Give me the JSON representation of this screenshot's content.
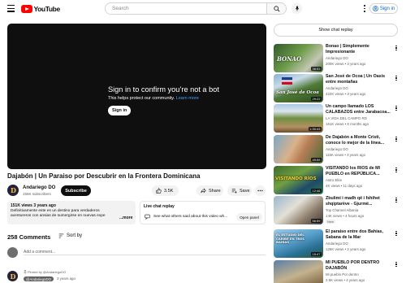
{
  "header": {
    "logo_text": "YouTube",
    "search_placeholder": "Search",
    "signin_label": "Sign in"
  },
  "player": {
    "title": "Sign in to confirm you’re not a bot",
    "subtitle": "This helps protect our community.",
    "learn_more": "Learn more",
    "signin_label": "Sign in"
  },
  "video": {
    "title": "Dajabón | Un Paraiso por Descubrir en la Frontera Dominicana",
    "channel": "Andariego DO",
    "subscribers": "156K subscribers",
    "subscribe_label": "Subscribe",
    "likes": "3.5K",
    "share_label": "Share",
    "save_label": "Save",
    "views_line": "151K views  3 years ago",
    "description": "Definitivamente este es un destino para verdaderos aventureros con ansias de sumergirse en nuevas expe",
    "more_label": "...more"
  },
  "chat_replay": {
    "title": "Live chat replay",
    "text": "See what others said about this video wh...",
    "button": "Open panel"
  },
  "comments": {
    "count_label": "258 Comments",
    "sort_label": "Sort by",
    "add_placeholder": "Add a comment...",
    "pinned_label": "Pinned by @AndariegoDO",
    "first_author": "@AndariegoDO",
    "first_time": "3 years ago"
  },
  "sidebar": {
    "show_chat_label": "Show chat replay",
    "recommendations": [
      {
        "title": "Bonao | Simplemente Impresionante",
        "channel": "Andariego DO",
        "meta": "200K views • 3 years ago",
        "duration": "38:53",
        "badge": "",
        "thumb_text": "BONAO"
      },
      {
        "title": "San José de Ocoa | Un Oasis entre montañas",
        "channel": "Andariego DO",
        "meta": "422K views • 3 years ago",
        "duration": "29:22",
        "badge": "",
        "thumb_text": "San José de Ocoa"
      },
      {
        "title": "Un campo llamado LOS CALABAZOS entre Jarabacoa...",
        "channel": "LA VIDA DEL CAMPO RD",
        "meta": "161K views • 8 months ago",
        "duration": "1:30:43",
        "badge": "",
        "thumb_text": ""
      },
      {
        "title": "De Dajabón a Monte Cristi, conoce lo mejor de la línea...",
        "channel": "Andariego DO",
        "meta": "115K views • 3 years ago",
        "duration": "49:59",
        "badge": "",
        "thumb_text": ""
      },
      {
        "title": "VISITANDO los RÍOS de MI PUEBLO en REPÚBLICA...",
        "channel": "Astro Elite",
        "meta": "4K views • 11 days ago",
        "duration": "12:46",
        "badge": "",
        "thumb_text": "VISITANDO RÍOS"
      },
      {
        "title": "Zbulimi i madh që i fshihet shqiptarëve - Gjurmë...",
        "channel": "Top Channel Albania",
        "meta": "14K views • 4 hours ago",
        "duration": "56:59",
        "badge": "New",
        "thumb_text": ""
      },
      {
        "title": "El paraíso entre dos Bahías, Sabana de la Mar",
        "channel": "Andariego DO",
        "meta": "125K views • 2 years ago",
        "duration": "15:47",
        "badge": "",
        "thumb_text": "EL ESTUDIO DEL CARIBE EN TRES BAHÍAS"
      },
      {
        "title": "MI PUEBLO POR DENTRO DAJABÓN",
        "channel": "Mi pueblo Por dentro",
        "meta": "2.5K views • 4 years ago",
        "duration": "",
        "badge": "",
        "thumb_text": ""
      }
    ]
  }
}
